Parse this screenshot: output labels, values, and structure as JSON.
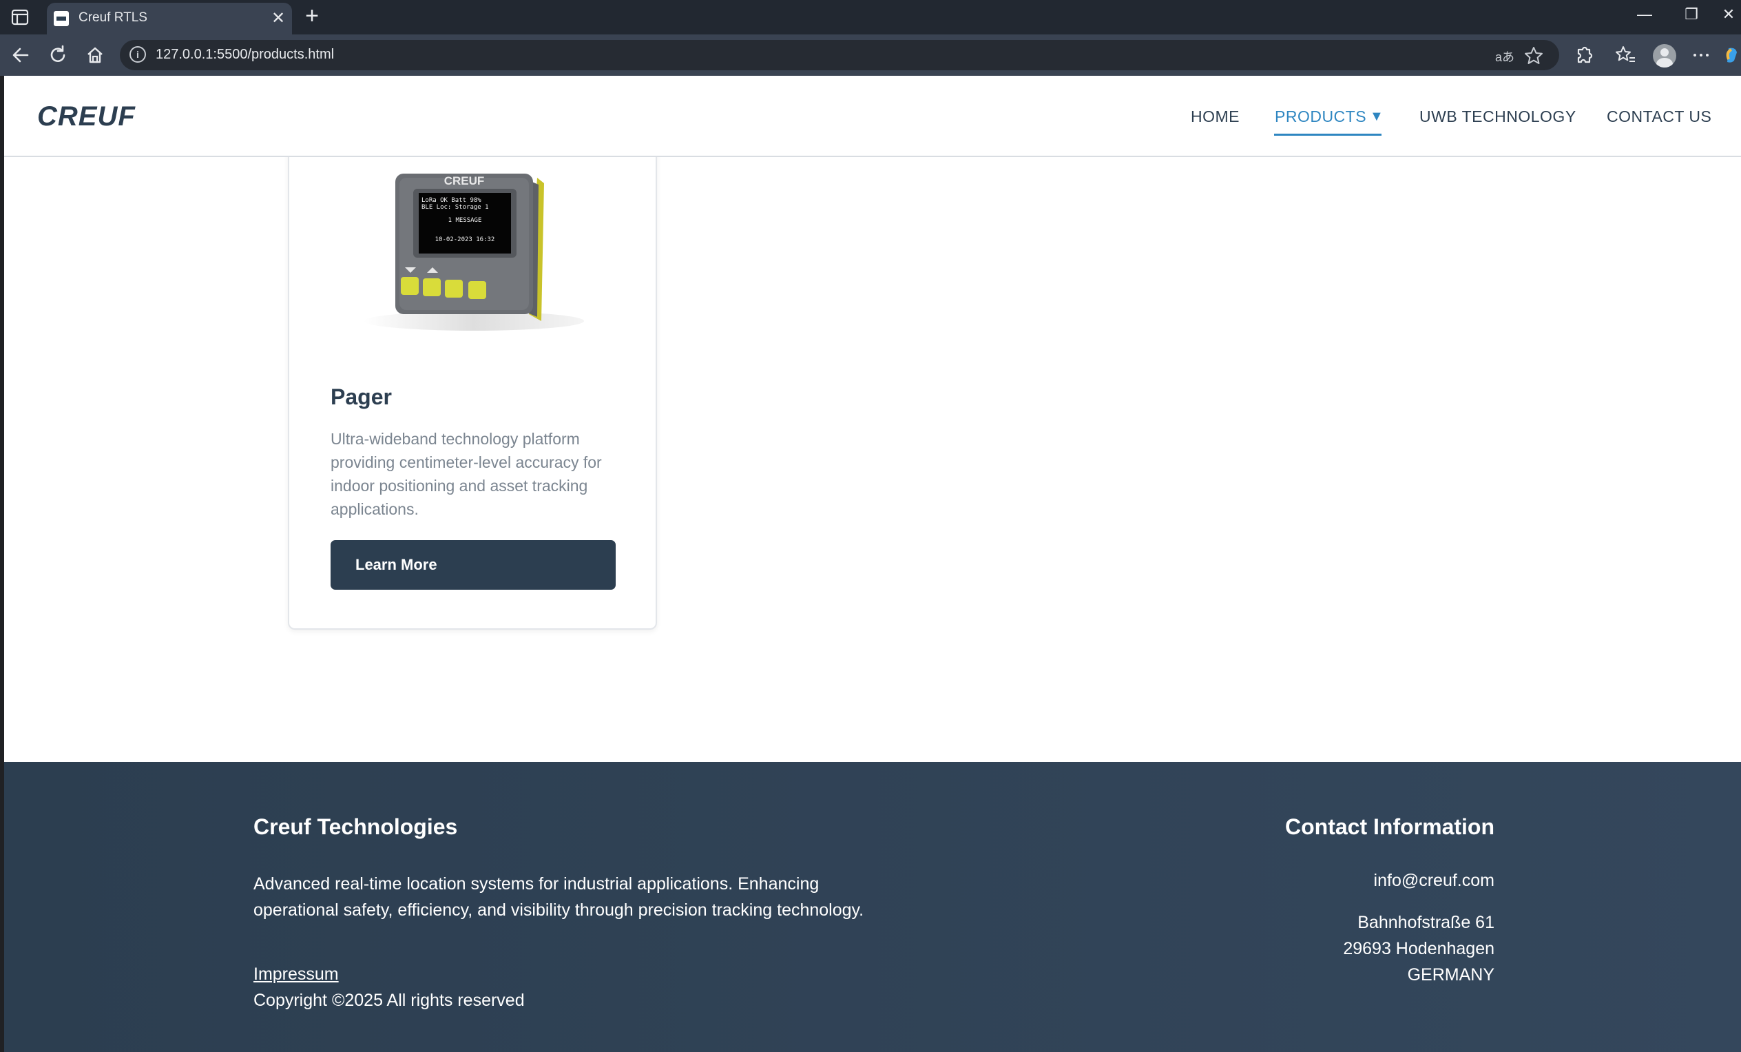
{
  "browser": {
    "tab_title": "Creuf RTLS",
    "tab_close": "✕",
    "new_tab": "+",
    "url": "127.0.0.1:5500/products.html",
    "read_aloud_icon": "aあ",
    "minimize": "—",
    "restore": "❐",
    "close": "✕"
  },
  "header": {
    "logo_text": "CREUF",
    "nav": [
      {
        "label": "HOME"
      },
      {
        "label": "PRODUCTS"
      },
      {
        "label": "UWB TECHNOLOGY"
      },
      {
        "label": "CONTACT US"
      }
    ],
    "dropdown_arrow": "▼",
    "accent_color": "#2e86c1"
  },
  "product_card": {
    "image_screen_lines": [
      "LoRa OK      Batt 98%",
      "BLE Loc: Storage 1",
      "1 MESSAGE",
      "10-02-2023 16:32"
    ],
    "image_brand": "CREUF",
    "title": "Pager",
    "description": "Ultra-wideband technology platform providing centimeter-level accuracy for indoor positioning and asset tracking applications.",
    "button_label": "Learn More"
  },
  "footer": {
    "left_title": "Creuf Technologies",
    "description": "Advanced real-time location systems for industrial applications. Enhancing operational safety, efficiency, and visibility through precision tracking technology.",
    "impressum": "Impressum",
    "copyright": "Copyright ©2025 All rights reserved",
    "right_title": "Contact Information",
    "email": "info@creuf.com",
    "address": [
      "Bahnhofstraße 61",
      "29693 Hodenhagen",
      "GERMANY"
    ]
  },
  "colors": {
    "primary": "#2c3e50",
    "accent": "#2e86c1",
    "button_yellow": "#d9dc3a"
  }
}
